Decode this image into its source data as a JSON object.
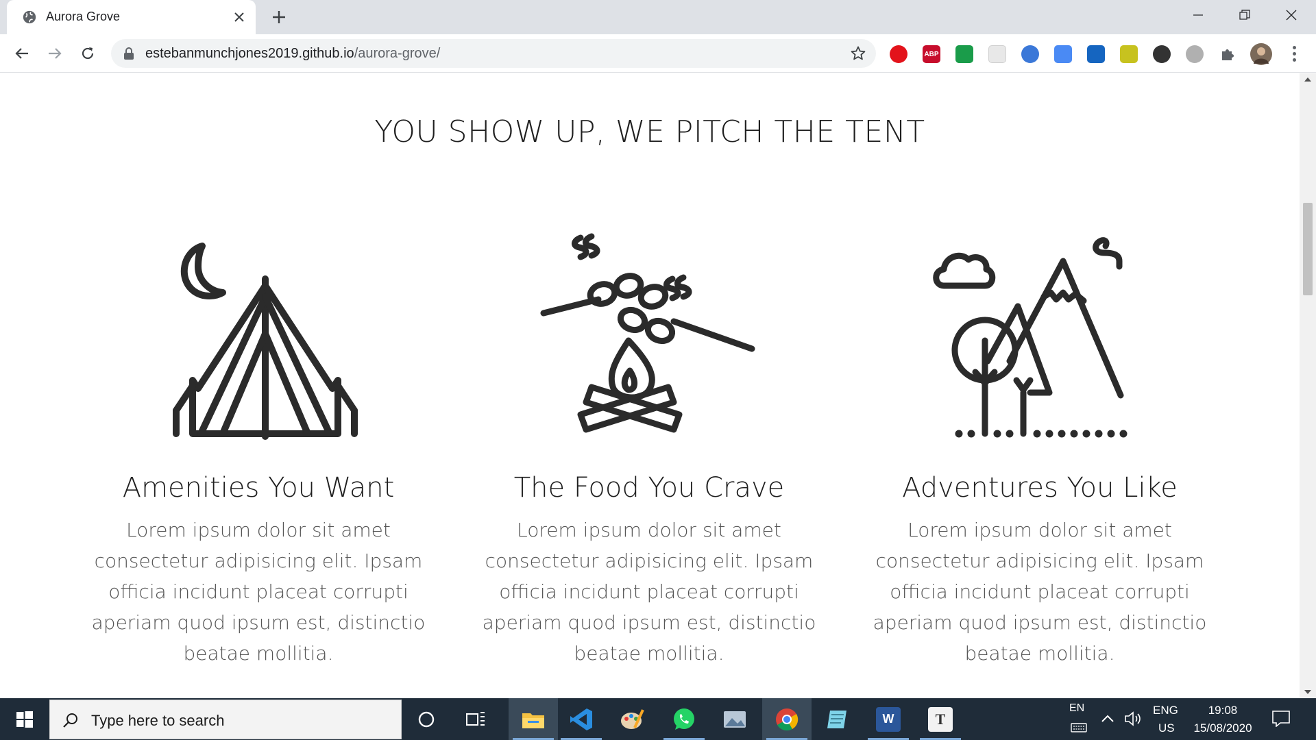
{
  "browser": {
    "tab_title": "Aurora Grove",
    "url_host": "estebanmunchjones2019.github.io",
    "url_path": "/aurora-grove/",
    "extensions": [
      {
        "name": "adblock-icon",
        "label": "",
        "color": "#e3131b"
      },
      {
        "name": "abp-icon",
        "label": "ABP",
        "color": "#c70d2c"
      },
      {
        "name": "tab-resize-icon",
        "label": "",
        "color": "#1a9c4a"
      },
      {
        "name": "blank-ext-icon",
        "label": "",
        "color": "#e8e8e8"
      },
      {
        "name": "blue-circle-ext-icon",
        "label": "",
        "color": "#3b78d8"
      },
      {
        "name": "cast-ext-icon",
        "label": "",
        "color": "#4a8af4"
      },
      {
        "name": "crop-ext-icon",
        "label": "",
        "color": "#1565c0"
      },
      {
        "name": "yellow-ext-icon",
        "label": "",
        "color": "#c7c21f"
      },
      {
        "name": "dark-mode-ext-icon",
        "label": "",
        "color": "#333333"
      },
      {
        "name": "circle-ext-icon",
        "label": "",
        "color": "#b0b0b0"
      },
      {
        "name": "puzzle-icon",
        "label": "",
        "color": "#5f6368"
      }
    ]
  },
  "page": {
    "section_title": "YOU SHOW UP, WE PITCH THE TENT",
    "features": [
      {
        "title": "Amenities You Want",
        "text": "Lorem ipsum dolor sit amet consectetur adipisicing elit. Ipsam officia incidunt placeat corrupti aperiam quod ipsum est, distinctio beatae mollitia.",
        "icon": "tent-icon"
      },
      {
        "title": "The Food You Crave",
        "text": "Lorem ipsum dolor sit amet consectetur adipisicing elit. Ipsam officia incidunt placeat corrupti aperiam quod ipsum est, distinctio beatae mollitia.",
        "icon": "campfire-icon"
      },
      {
        "title": "Adventures You Like",
        "text": "Lorem ipsum dolor sit amet consectetur adipisicing elit. Ipsam officia incidunt placeat corrupti aperiam quod ipsum est, distinctio beatae mollitia.",
        "icon": "mountains-icon"
      }
    ]
  },
  "taskbar": {
    "search_placeholder": "Type here to search",
    "apps": [
      "cortana-icon",
      "task-view-icon",
      "file-explorer-icon",
      "vscode-icon",
      "paint-icon",
      "whatsapp-icon",
      "photos-icon",
      "chrome-icon",
      "notepad-icon",
      "word-icon",
      "typora-icon"
    ],
    "lang_top": "EN",
    "input_top": "ENG",
    "input_bottom": "US",
    "time": "19:08",
    "date": "15/08/2020"
  },
  "colors": {
    "icon_stroke": "#2b2b2b",
    "taskbar_bg": "#1f2c39",
    "tab_bar_bg": "#dee1e6"
  }
}
